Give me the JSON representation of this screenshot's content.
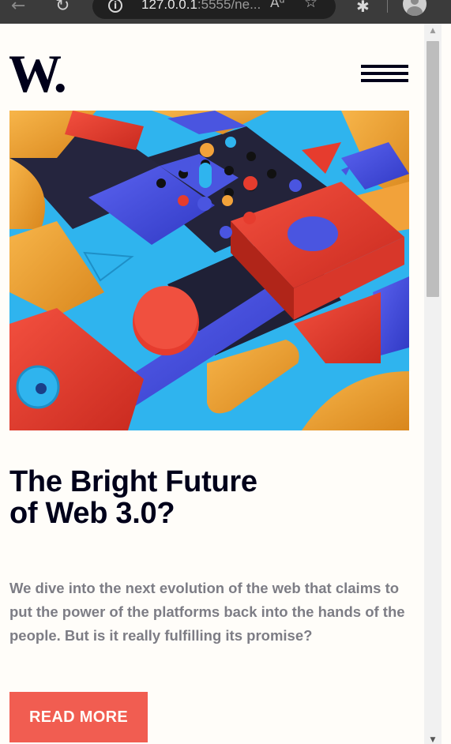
{
  "browser": {
    "url_host": "127.0.0.1",
    "url_rest": ":5555/ne...",
    "icons": [
      "back-arrow-icon",
      "reload-icon",
      "info-icon",
      "read-aloud-icon",
      "add-favorite-icon",
      "extensions-icon",
      "profile-avatar-icon"
    ]
  },
  "header": {
    "logo_text": "W.",
    "menu_icon": "hamburger-menu-icon"
  },
  "hero": {
    "image_description": "colorful 3D geometric blocks"
  },
  "article": {
    "title": "The Bright Future of Web 3.0?",
    "description": "We dive into the next evolution of the web that claims to put the power of the platforms back into the hands of the people. But is it really fulfilling its promise?",
    "cta_label": "READ MORE"
  },
  "colors": {
    "background": "#fffdf9",
    "dark": "#00001a",
    "accent": "#f15d51",
    "muted_text": "#7d7d85",
    "hero_blue": "#4a55e0",
    "hero_red": "#e63c2e",
    "hero_orange": "#f2a23a",
    "hero_cyan": "#2fb4ee"
  }
}
